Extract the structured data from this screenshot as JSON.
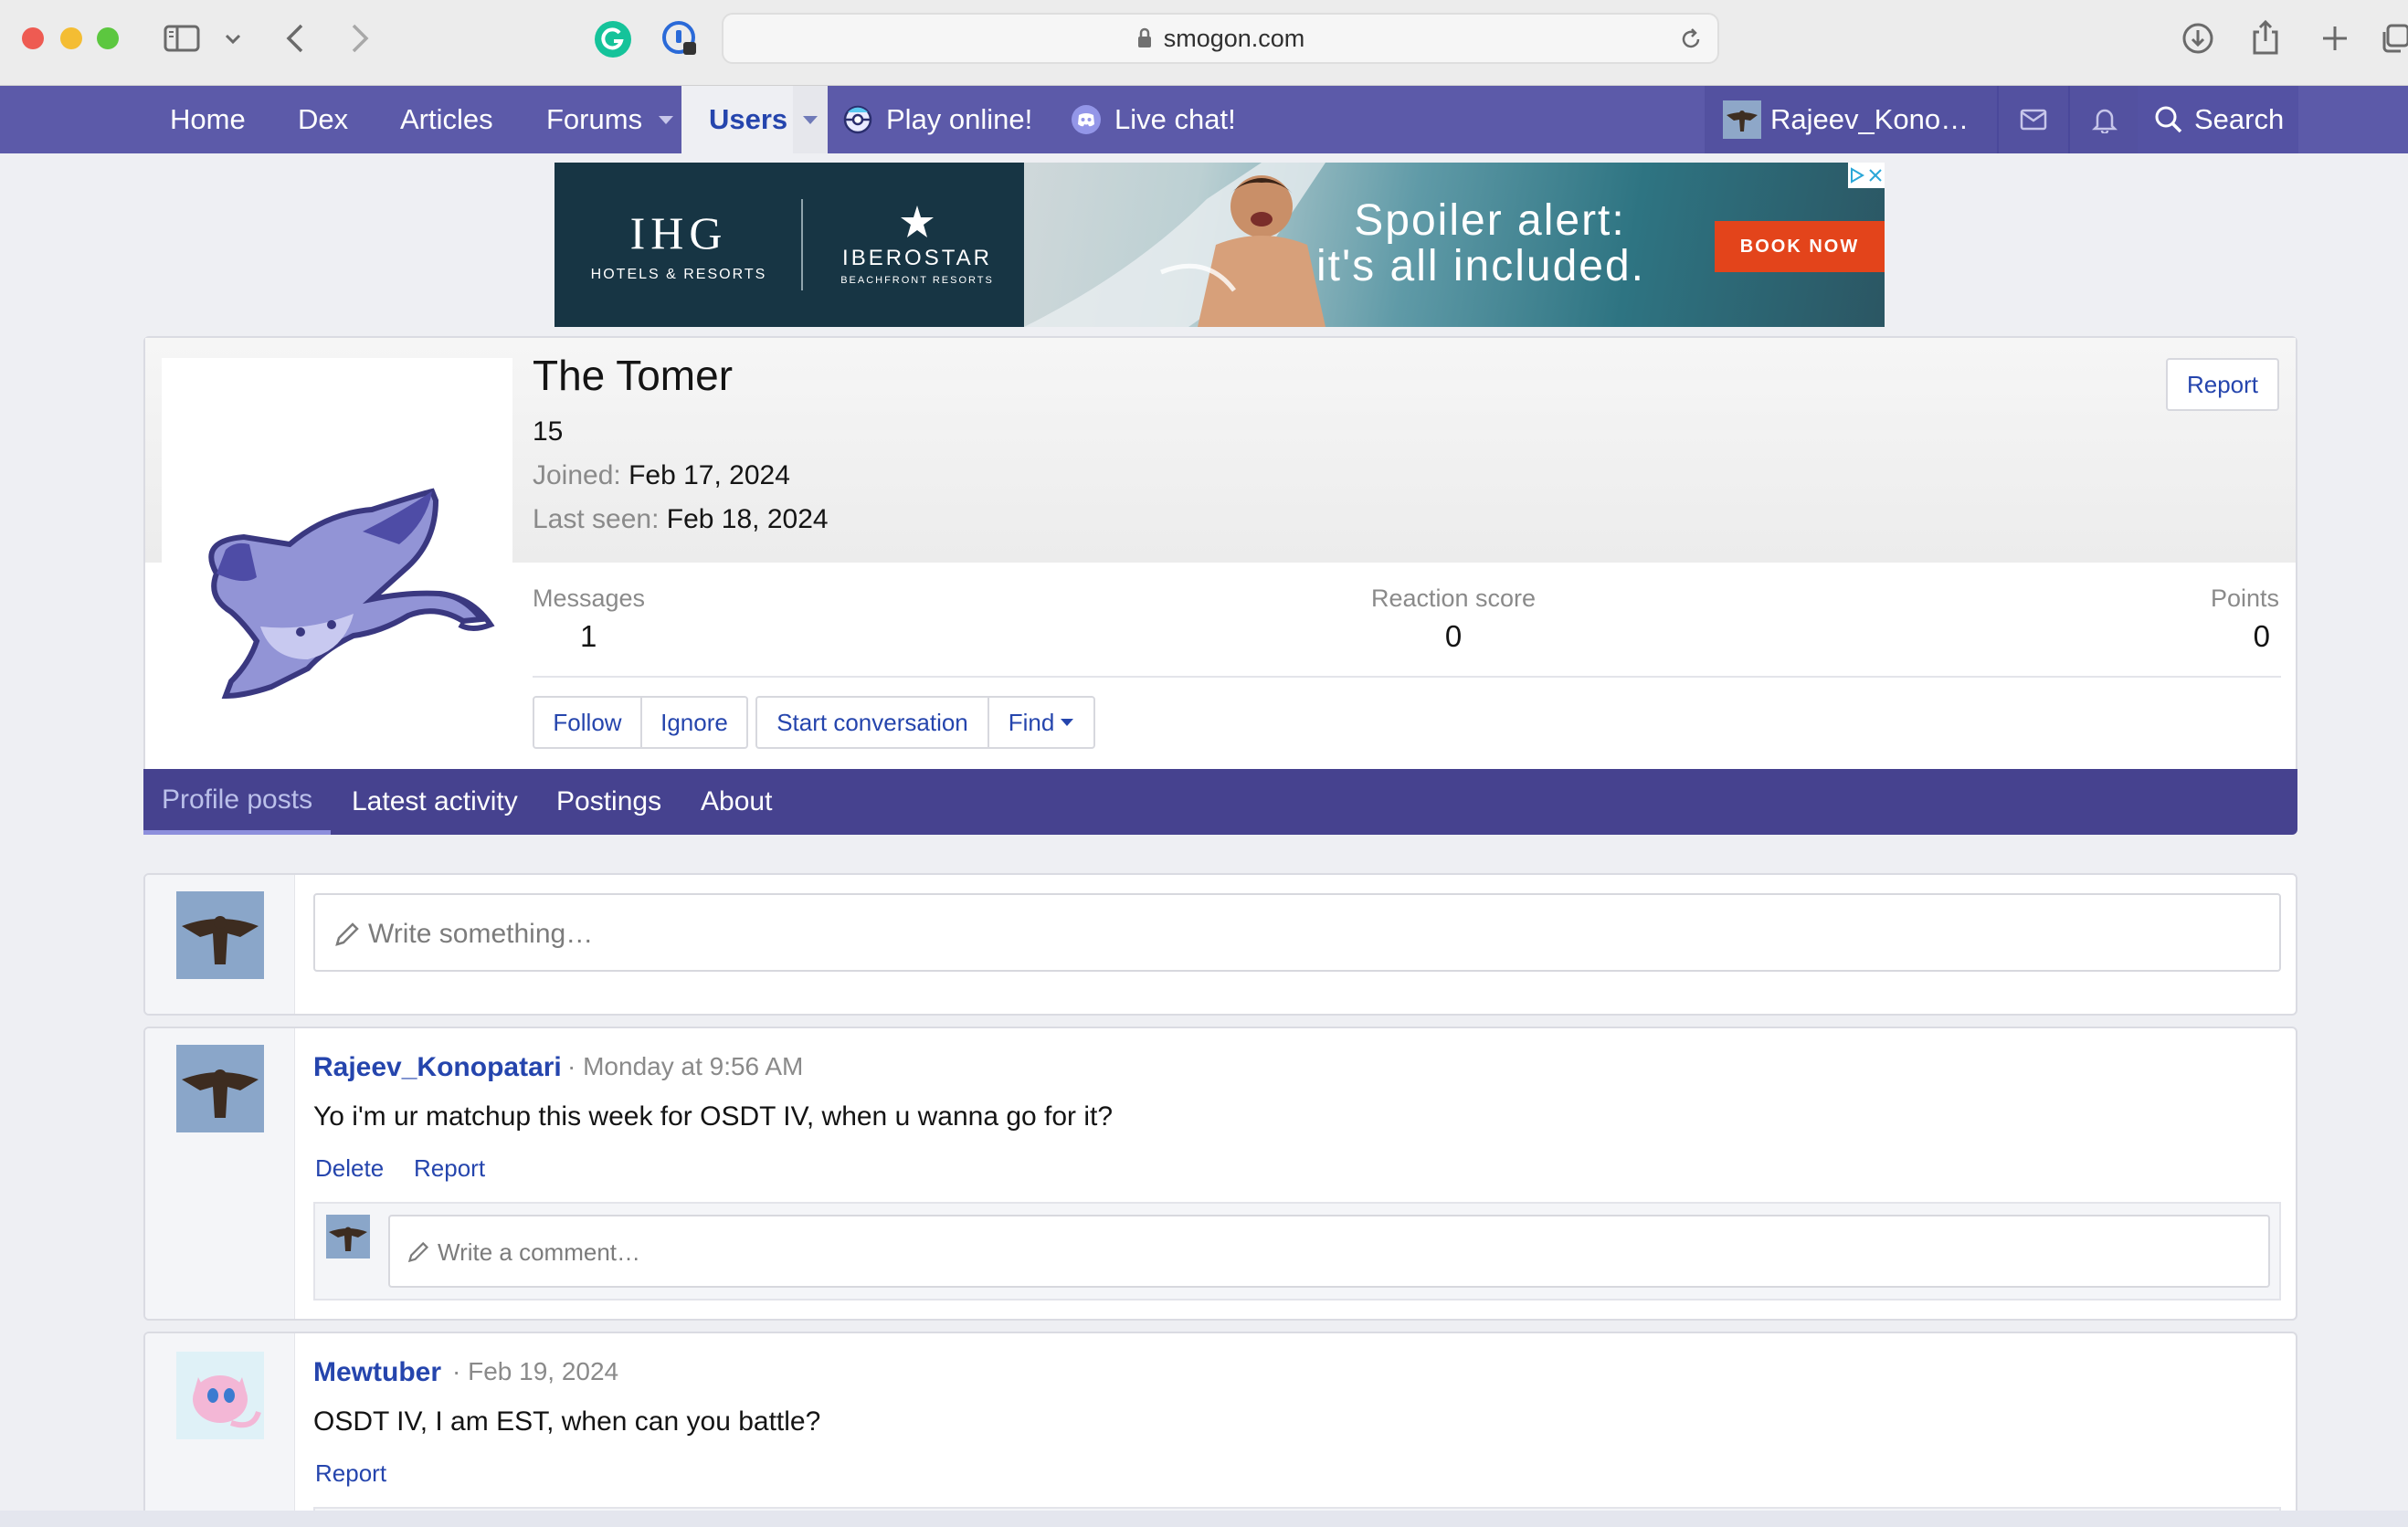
{
  "browser": {
    "url": "smogon.com"
  },
  "nav": {
    "home": "Home",
    "dex": "Dex",
    "articles": "Articles",
    "forums": "Forums",
    "users": "Users",
    "play_online": "Play online!",
    "live_chat": "Live chat!",
    "account": "Rajeev_Kono…",
    "search": "Search"
  },
  "ad": {
    "brand1": "IHG",
    "brand1_sub": "HOTELS & RESORTS",
    "brand2": "IBEROSTAR",
    "brand2_sub": "BEACHFRONT RESORTS",
    "headline1": "Spoiler alert:",
    "headline2": "it's all included.",
    "cta": "BOOK NOW"
  },
  "profile": {
    "name": "The Tomer",
    "title": "15",
    "joined_label": "Joined:",
    "joined_value": "Feb 17, 2024",
    "last_seen_label": "Last seen:",
    "last_seen_value": "Feb 18, 2024",
    "report": "Report",
    "stats": {
      "messages_label": "Messages",
      "messages_value": "1",
      "reaction_label": "Reaction score",
      "reaction_value": "0",
      "points_label": "Points",
      "points_value": "0"
    },
    "buttons": {
      "follow": "Follow",
      "ignore": "Ignore",
      "start_conversation": "Start conversation",
      "find": "Find"
    }
  },
  "tabs": [
    "Profile posts",
    "Latest activity",
    "Postings",
    "About"
  ],
  "composer": {
    "placeholder": "Write something…"
  },
  "posts": [
    {
      "author": "Rajeev_Konopatari",
      "time": "· Monday at 9:56 AM",
      "body": "Yo i'm ur matchup this week for OSDT IV, when u wanna go for it?",
      "delete": "Delete",
      "report": "Report",
      "comment_placeholder": "Write a comment…"
    },
    {
      "author": "Mewtuber",
      "time": "· Feb 19, 2024",
      "body": "OSDT IV, I am EST, when can you battle?",
      "report": "Report"
    }
  ],
  "colors": {
    "nav_bg": "#5c5aa9",
    "tab_bg": "#46428f",
    "link": "#2545ad",
    "ad_cta": "#e3441b"
  }
}
